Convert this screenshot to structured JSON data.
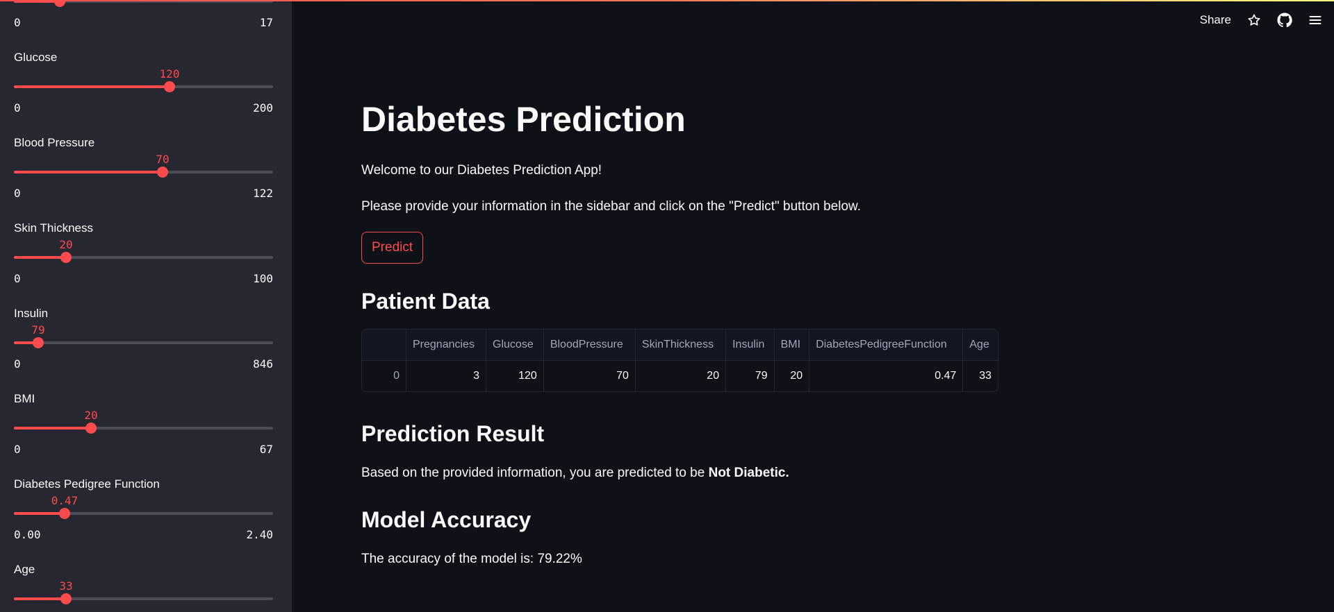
{
  "app": {
    "accent": "#ff4b4b",
    "background": "#0e1117",
    "sidebar_background": "#262730"
  },
  "header": {
    "share_label": "Share",
    "icons": [
      "star-icon",
      "github-icon",
      "menu-icon"
    ]
  },
  "sidebar": {
    "sliders": [
      {
        "label": "",
        "value": "",
        "value_num": 3,
        "min": "0",
        "max": "17",
        "min_num": 0,
        "max_num": 17
      },
      {
        "label": "Glucose",
        "value": "120",
        "value_num": 120,
        "min": "0",
        "max": "200",
        "min_num": 0,
        "max_num": 200
      },
      {
        "label": "Blood Pressure",
        "value": "70",
        "value_num": 70,
        "min": "0",
        "max": "122",
        "min_num": 0,
        "max_num": 122
      },
      {
        "label": "Skin Thickness",
        "value": "20",
        "value_num": 20,
        "min": "0",
        "max": "100",
        "min_num": 0,
        "max_num": 100
      },
      {
        "label": "Insulin",
        "value": "79",
        "value_num": 79,
        "min": "0",
        "max": "846",
        "min_num": 0,
        "max_num": 846
      },
      {
        "label": "BMI",
        "value": "20",
        "value_num": 20,
        "min": "0",
        "max": "67",
        "min_num": 0,
        "max_num": 67
      },
      {
        "label": "Diabetes Pedigree Function",
        "value": "0.47",
        "value_num": 0.47,
        "min": "0.00",
        "max": "2.40",
        "min_num": 0,
        "max_num": 2.4
      },
      {
        "label": "Age",
        "value": "33",
        "value_num": 33,
        "min": "",
        "max": "",
        "min_num": 21,
        "max_num": 81
      }
    ]
  },
  "main": {
    "title": "Diabetes Prediction",
    "welcome": "Welcome to our Diabetes Prediction App!",
    "instructions": "Please provide your information in the sidebar and click on the \"Predict\" button below.",
    "predict_label": "Predict",
    "patient_data_heading": "Patient Data",
    "table": {
      "columns": [
        "",
        "Pregnancies",
        "Glucose",
        "BloodPressure",
        "SkinThickness",
        "Insulin",
        "BMI",
        "DiabetesPedigreeFunction",
        "Age"
      ],
      "rows": [
        [
          "0",
          "3",
          "120",
          "70",
          "20",
          "79",
          "20",
          "0.47",
          "33"
        ]
      ]
    },
    "prediction_heading": "Prediction Result",
    "prediction_text": "Based on the provided information, you are predicted to be ",
    "prediction_value": "Not Diabetic.",
    "accuracy_heading": "Model Accuracy",
    "accuracy_text": "The accuracy of the model is: 79.22%"
  }
}
